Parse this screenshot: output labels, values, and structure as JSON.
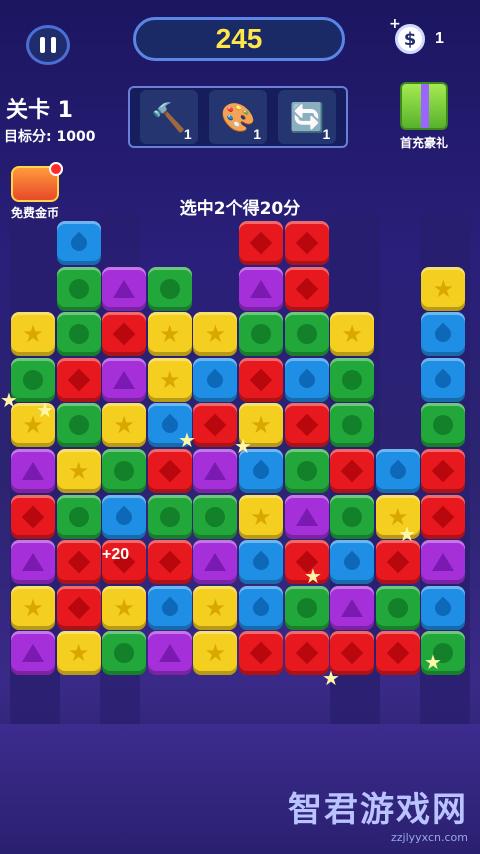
{
  "hud": {
    "score": "245",
    "coin_plus": "+",
    "coin_symbol": "$",
    "coin_count": "1",
    "level_label": "关卡 1",
    "target_label": "目标分: 1000",
    "hint": "选中2个得20分",
    "gift_label": "首充豪礼",
    "free_coin_label": "免费金币"
  },
  "tools": [
    {
      "icon": "hammer-icon",
      "glyph": "🔨",
      "count": "1"
    },
    {
      "icon": "color-bomb-icon",
      "glyph": "🎨",
      "count": "1"
    },
    {
      "icon": "swap-arrows-icon",
      "glyph": "🔄",
      "count": "1"
    }
  ],
  "popup": "+20",
  "watermark": {
    "title": "智君游戏网",
    "sub": "zzjlyyxcn.com"
  },
  "board": {
    "rows": [
      [
        "",
        "blue",
        "",
        "",
        "",
        "red",
        "red",
        "",
        "",
        ""
      ],
      [
        "",
        "green",
        "purple",
        "green",
        "",
        "purple",
        "red",
        "",
        "",
        "yellow"
      ],
      [
        "yellow",
        "green",
        "red",
        "yellow",
        "yellow",
        "green",
        "green",
        "yellow",
        "",
        "blue"
      ],
      [
        "green",
        "red",
        "purple",
        "yellow",
        "blue",
        "red",
        "blue",
        "green",
        "",
        "blue"
      ],
      [
        "yellow",
        "green",
        "yellow",
        "blue",
        "red",
        "yellow",
        "red",
        "green",
        "",
        "green"
      ],
      [
        "purple",
        "yellow",
        "green",
        "red",
        "purple",
        "blue",
        "green",
        "red",
        "blue",
        "red"
      ],
      [
        "red",
        "green",
        "blue",
        "green",
        "green",
        "yellow",
        "purple",
        "green",
        "yellow",
        "red"
      ],
      [
        "purple",
        "red",
        "red",
        "red",
        "purple",
        "blue",
        "red",
        "blue",
        "red",
        "purple"
      ],
      [
        "yellow",
        "red",
        "yellow",
        "blue",
        "yellow",
        "blue",
        "green",
        "purple",
        "green",
        "blue"
      ],
      [
        "purple",
        "yellow",
        "green",
        "purple",
        "yellow",
        "red",
        "red",
        "red",
        "red",
        "green"
      ]
    ]
  }
}
